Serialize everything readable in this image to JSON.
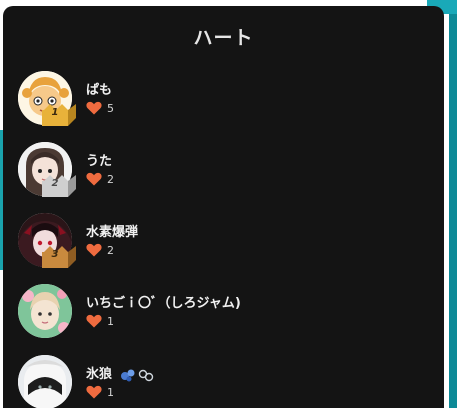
{
  "header": {
    "title": "ハート"
  },
  "ranking": [
    {
      "name": "ぱも",
      "hearts": "5",
      "rank": "1",
      "medal": "gold"
    },
    {
      "name": "うた",
      "hearts": "2",
      "rank": "2",
      "medal": "silver"
    },
    {
      "name": "水素爆弾",
      "hearts": "2",
      "rank": "3",
      "medal": "bronze"
    },
    {
      "name": "いちごｉ〇ﾞ（しろジャム)",
      "hearts": "1",
      "rank": "",
      "medal": "none"
    },
    {
      "name": "氷狼",
      "hearts": "1",
      "rank": "",
      "medal": "none"
    }
  ],
  "colors": {
    "panel_bg": "#141414",
    "heart": "#ef6b3f",
    "gold": "#e8b23a",
    "silver": "#cfcfcf",
    "bronze": "#c98a3e",
    "accent_teal": "#19a9b8"
  },
  "icons": {
    "heart": "heart-icon",
    "gold_medal": "rank-1-badge",
    "silver_medal": "rank-2-badge",
    "bronze_medal": "rank-3-badge"
  }
}
